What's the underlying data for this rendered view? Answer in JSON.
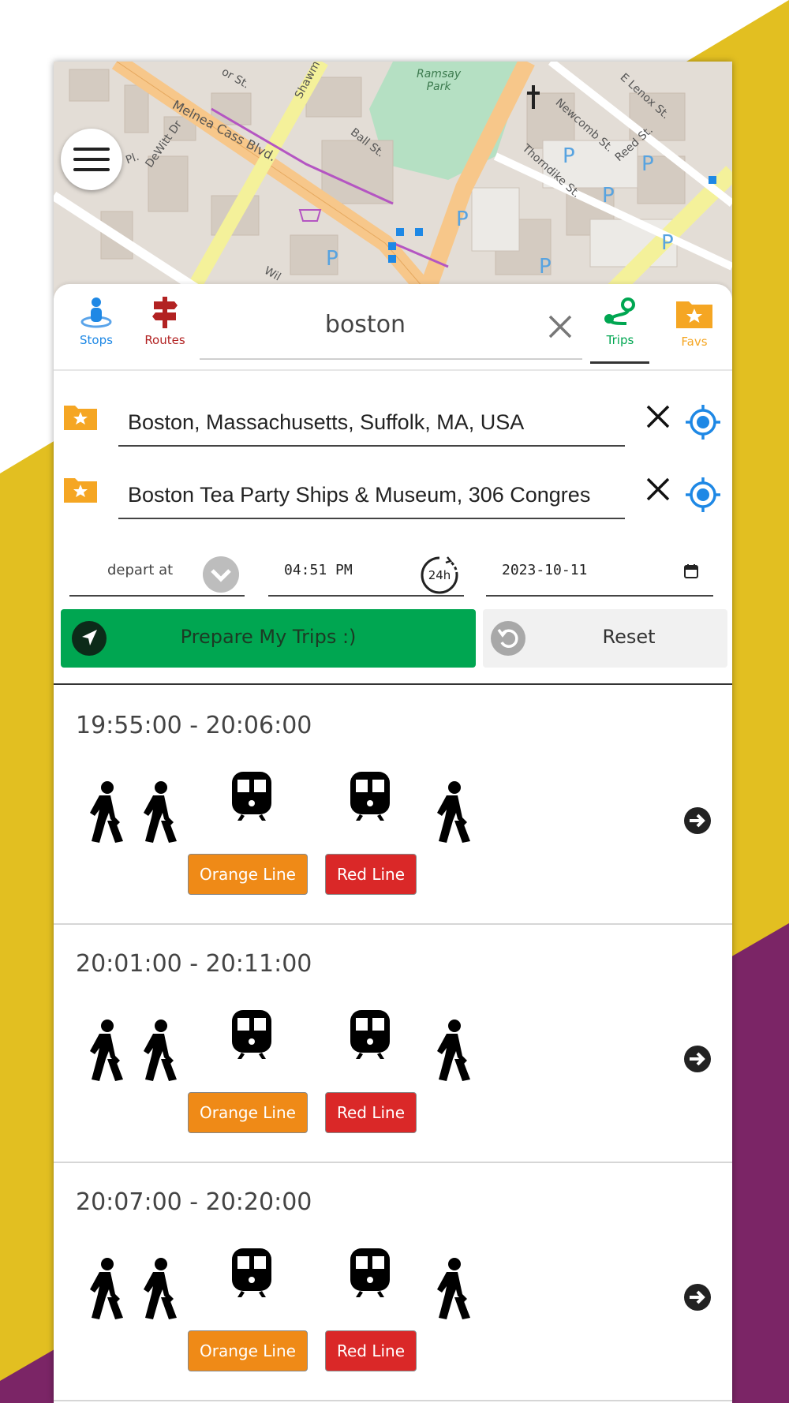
{
  "colors": {
    "accent_green": "#00a651",
    "stops_blue": "#1e88e5",
    "routes_red": "#b22222",
    "favs_orange": "#f5a623",
    "orange_line": "#ef8a17",
    "red_line": "#da2828",
    "bg_yellow": "#e2bf21",
    "bg_purple": "#7b2566"
  },
  "map": {
    "labels": {
      "park": "Ramsay\nPark",
      "street_melnea": "Melnea Cass Blvd.",
      "street_ball": "Ball St.",
      "street_shawmut": "Shawm",
      "street_dewitt": "DeWitt Dr",
      "street_newcomb": "Newcomb St.",
      "street_thorndike": "Thorndike St.",
      "street_reed": "Reed St.",
      "street_lenox": "E Lenox St.",
      "street_or": "or St.",
      "street_pl": "Pl.",
      "street_wil": "Wil"
    }
  },
  "nav": {
    "stops_label": "Stops",
    "routes_label": "Routes",
    "trips_label": "Trips",
    "favs_label": "Favs"
  },
  "search": {
    "value": "boston"
  },
  "origin": {
    "value": "Boston, Massachusetts, Suffolk, MA, USA"
  },
  "destination": {
    "value": "Boston Tea Party Ships & Museum, 306 Congres"
  },
  "depart": {
    "mode": "depart at",
    "time": "04:51 PM",
    "clock_label": "24h",
    "date": "2023-10-11"
  },
  "actions": {
    "prepare_label": "Prepare My Trips :)",
    "reset_label": "Reset"
  },
  "trips": [
    {
      "time_range": "19:55:00 - 20:06:00",
      "legs": [
        "walk",
        "walk",
        "train",
        "train",
        "walk"
      ],
      "lines": [
        "Orange Line",
        "Red Line"
      ]
    },
    {
      "time_range": "20:01:00 - 20:11:00",
      "legs": [
        "walk",
        "walk",
        "train",
        "train",
        "walk"
      ],
      "lines": [
        "Orange Line",
        "Red Line"
      ]
    },
    {
      "time_range": "20:07:00 - 20:20:00",
      "legs": [
        "walk",
        "walk",
        "train",
        "train",
        "walk"
      ],
      "lines": [
        "Orange Line",
        "Red Line"
      ]
    }
  ]
}
